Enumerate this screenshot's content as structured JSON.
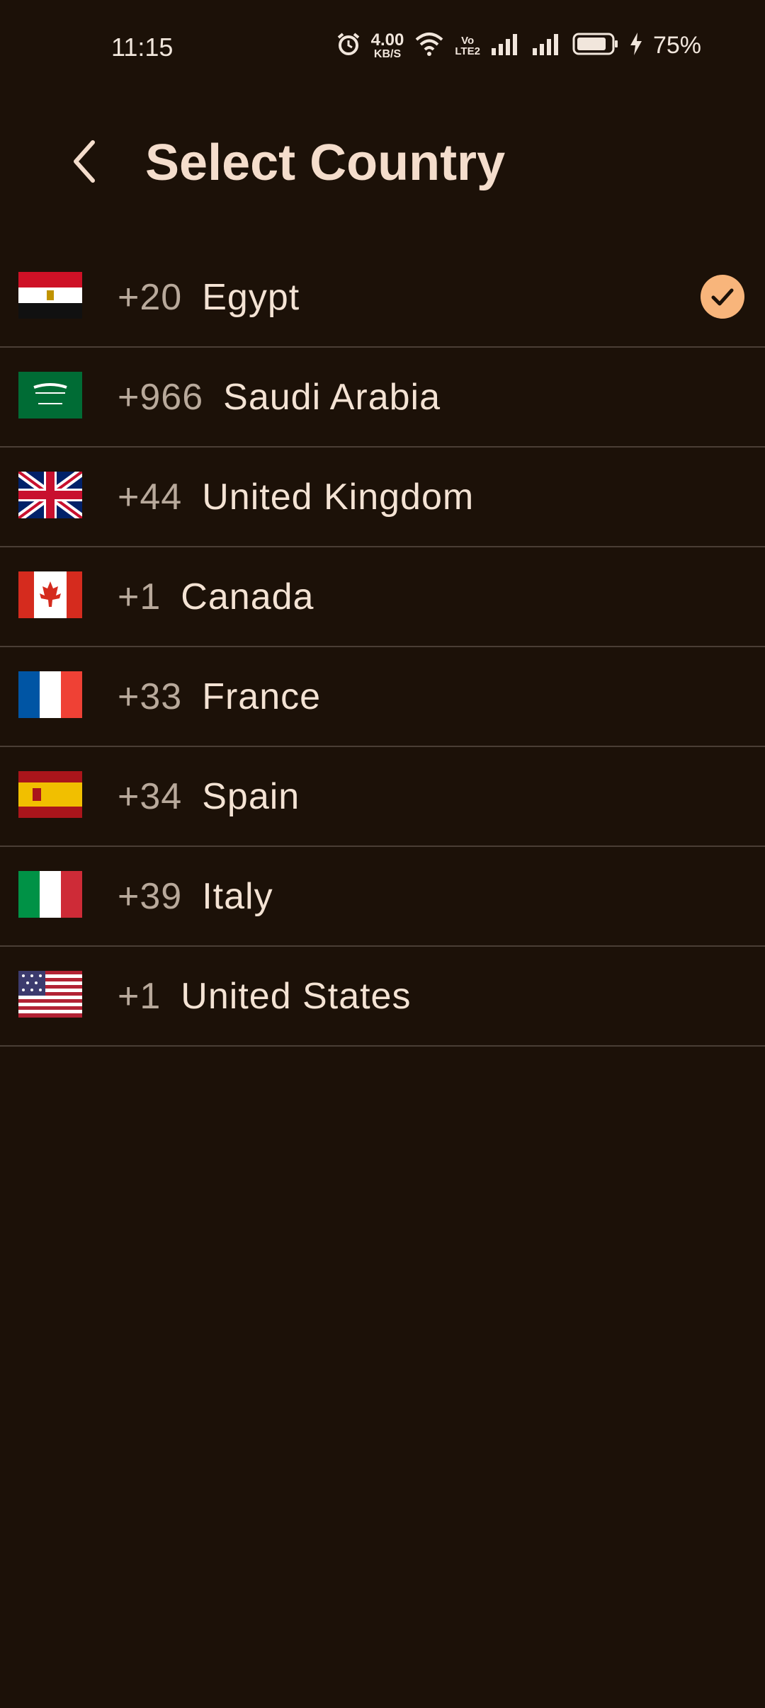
{
  "status_bar": {
    "time": "11:15",
    "net_speed_value": "4.00",
    "net_speed_unit": "KB/S",
    "volte_line1": "Vo",
    "volte_line2": "LTE2",
    "battery_percent": "75%",
    "icons": [
      "alarm-icon",
      "wifi-icon",
      "volte-icon",
      "signal-icon",
      "signal-icon",
      "battery-icon",
      "charging-icon"
    ]
  },
  "header": {
    "title": "Select Country",
    "back_icon": "chevron-left-icon"
  },
  "countries": [
    {
      "code": "+20",
      "name": "Egypt",
      "flag": "egypt-flag-icon",
      "selected": true
    },
    {
      "code": "+966",
      "name": "Saudi Arabia",
      "flag": "saudi-arabia-flag-icon",
      "selected": false
    },
    {
      "code": "+44",
      "name": "United Kingdom",
      "flag": "united-kingdom-flag-icon",
      "selected": false
    },
    {
      "code": "+1",
      "name": "Canada",
      "flag": "canada-flag-icon",
      "selected": false
    },
    {
      "code": "+33",
      "name": "France",
      "flag": "france-flag-icon",
      "selected": false
    },
    {
      "code": "+34",
      "name": "Spain",
      "flag": "spain-flag-icon",
      "selected": false
    },
    {
      "code": "+39",
      "name": "Italy",
      "flag": "italy-flag-icon",
      "selected": false
    },
    {
      "code": "+1",
      "name": "United States",
      "flag": "united-states-flag-icon",
      "selected": false
    }
  ],
  "colors": {
    "background": "#1c1108",
    "accent": "#f8b57b",
    "divider": "#4a3e35",
    "title": "#f4ddcc"
  }
}
